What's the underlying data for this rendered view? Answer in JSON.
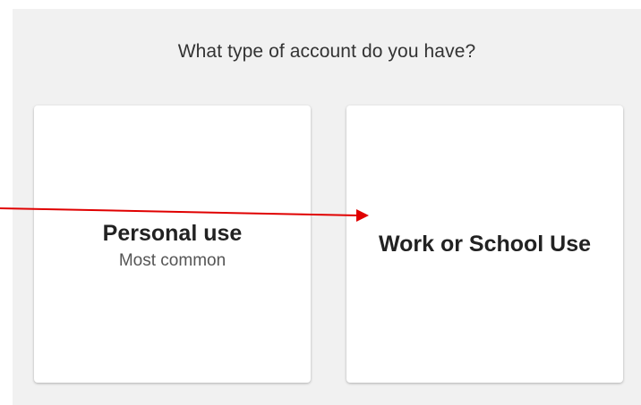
{
  "question": "What type of account do you have?",
  "cards": {
    "personal": {
      "title": "Personal use",
      "subtitle": "Most common"
    },
    "work": {
      "title": "Work or School Use"
    }
  },
  "colors": {
    "panel_background": "#f1f1f1",
    "card_background": "#ffffff",
    "annotation_arrow": "#e00000"
  }
}
